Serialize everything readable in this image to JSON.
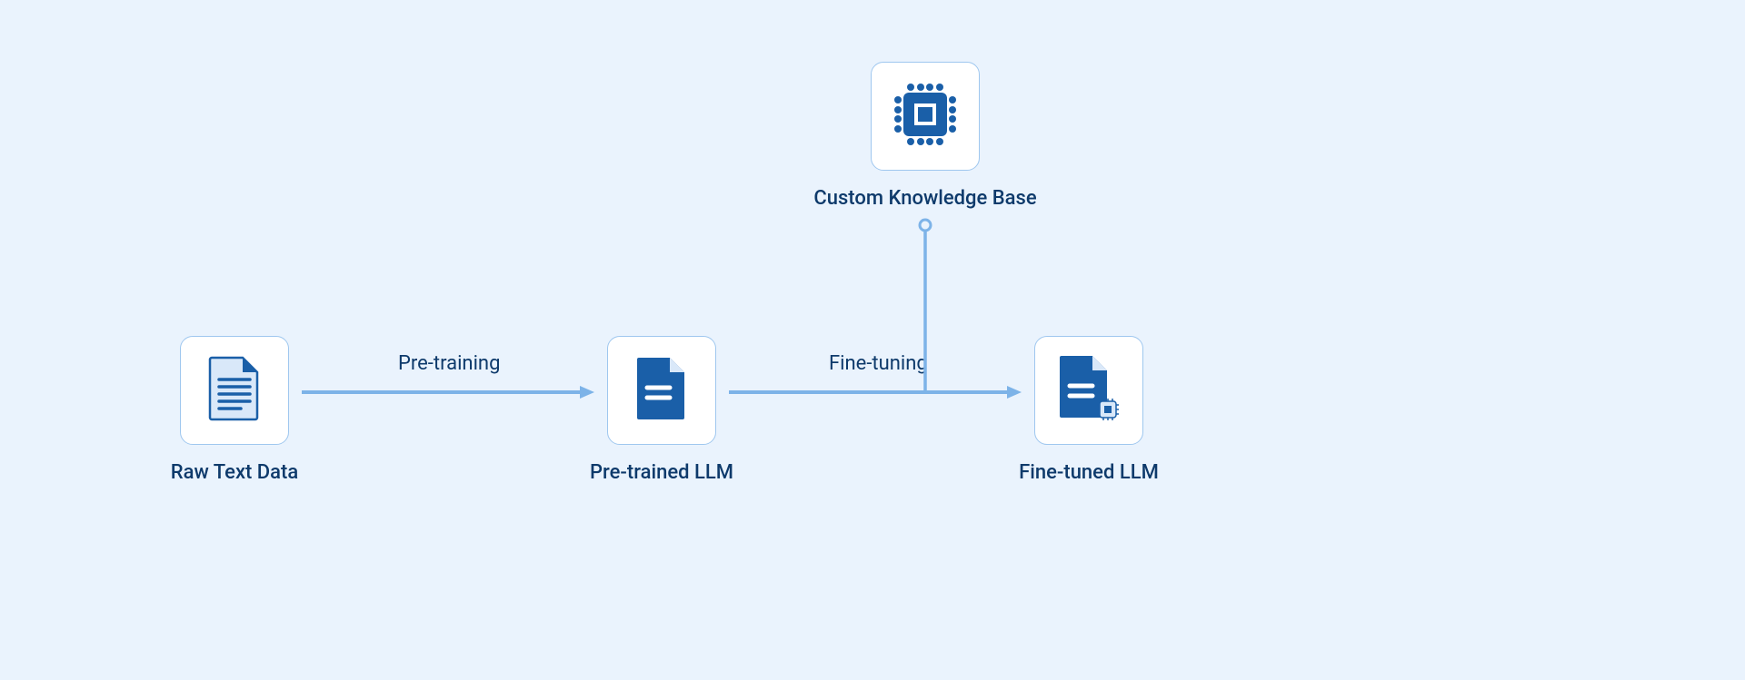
{
  "diagram": {
    "nodes": {
      "raw_text_data": {
        "label": "Raw Text Data",
        "icon": "document-lines-icon"
      },
      "pretrained_llm": {
        "label": "Pre-trained LLM",
        "icon": "document-solid-icon"
      },
      "custom_kb": {
        "label": "Custom Knowledge Base",
        "icon": "chip-icon"
      },
      "fine_tuned_llm": {
        "label": "Fine-tuned LLM",
        "icon": "document-chip-icon"
      }
    },
    "edges": {
      "pretraining": {
        "label": "Pre-training",
        "from": "raw_text_data",
        "to": "pretrained_llm"
      },
      "finetuning": {
        "label": "Fine-tuning",
        "from": "pretrained_llm",
        "to": "fine_tuned_llm"
      },
      "kb_input": {
        "from": "custom_kb",
        "to": "finetuning"
      }
    },
    "colors": {
      "background": "#eaf3fd",
      "node_bg": "#ffffff",
      "node_border": "#9fc7ef",
      "text": "#0e3a6b",
      "arrow": "#7db3e8",
      "icon_primary": "#1a5fa8",
      "icon_light": "#d9e8f9"
    }
  }
}
